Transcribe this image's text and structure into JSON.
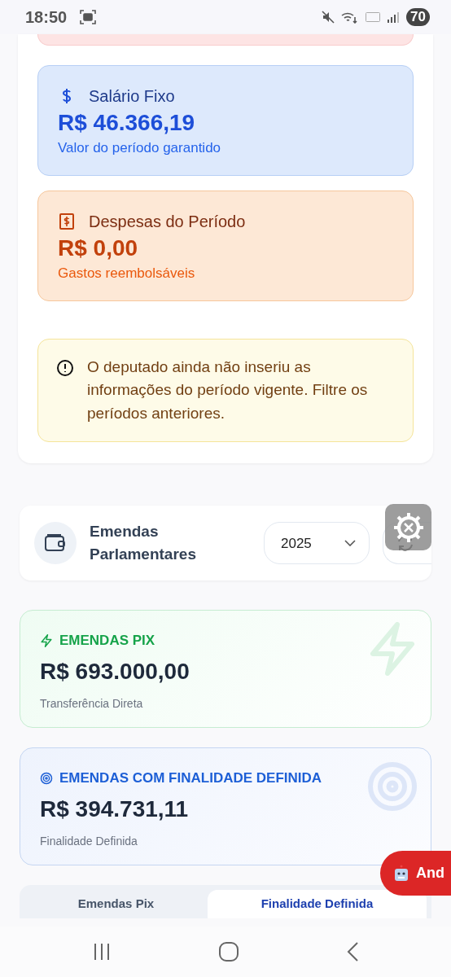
{
  "status_bar": {
    "time": "18:50",
    "battery": "70"
  },
  "period_cards": [
    {
      "kind": "salary",
      "title": "Salário Fixo",
      "amount": "R$ 46.366,19",
      "caption": "Valor do período garantido"
    },
    {
      "kind": "expenses",
      "title": "Despesas do Período",
      "amount": "R$ 0,00",
      "caption": "Gastos reembolsáveis"
    }
  ],
  "notice": {
    "text": "O deputado ainda não inseriu as informações do período vigente. Filtre os períodos anteriores."
  },
  "amendments_header": {
    "title": "Emendas Parlamentares",
    "year": "2025"
  },
  "amendment_cards": [
    {
      "kind": "pix",
      "title": "EMENDAS PIX",
      "amount": "R$ 693.000,00",
      "caption": "Transferência Direta"
    },
    {
      "kind": "defined",
      "title": "EMENDAS COM FINALIDADE DEFINIDA",
      "amount": "R$ 394.731,11",
      "caption": "Finalidade Definida"
    }
  ],
  "floating_button": {
    "label": "And"
  },
  "tabs": [
    {
      "label": "Emendas Pix",
      "selected": false
    },
    {
      "label": "Finalidade Definida",
      "selected": true
    }
  ]
}
